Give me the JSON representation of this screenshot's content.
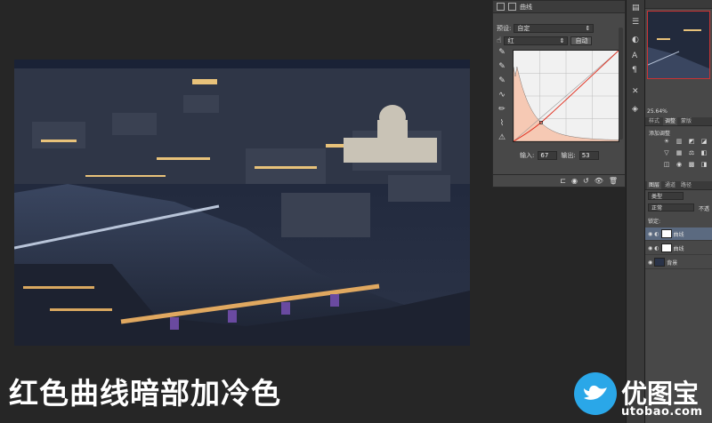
{
  "curves_panel": {
    "title": "曲线",
    "preset_label": "预设:",
    "preset_value": "自定",
    "channel_value": "红",
    "auto_button": "自动",
    "input_label": "输入:",
    "input_value": "67",
    "output_label": "输出:",
    "output_value": "53",
    "curve_point": {
      "input": 67,
      "output": 53
    },
    "colors": {
      "histogram": "#f6c9b4",
      "curve": "#e03020"
    }
  },
  "right_panel": {
    "zoom": "25.64%",
    "adjust_tabs": [
      "样式",
      "调整",
      "蒙版"
    ],
    "add_adjustment_label": "添加调整",
    "layers_tabs": [
      "图层",
      "通道",
      "路径"
    ],
    "filter_kind": "类型",
    "blend_mode": "正常",
    "opacity_label": "不透",
    "lock_label": "锁定:",
    "layers": [
      {
        "name": "曲线",
        "selected": true
      },
      {
        "name": "曲线",
        "selected": false
      },
      {
        "name": "背景",
        "selected": false
      }
    ]
  },
  "caption": "红色曲线暗部加冷色",
  "watermark": {
    "brand": "优图宝",
    "url": "utobao.com"
  }
}
